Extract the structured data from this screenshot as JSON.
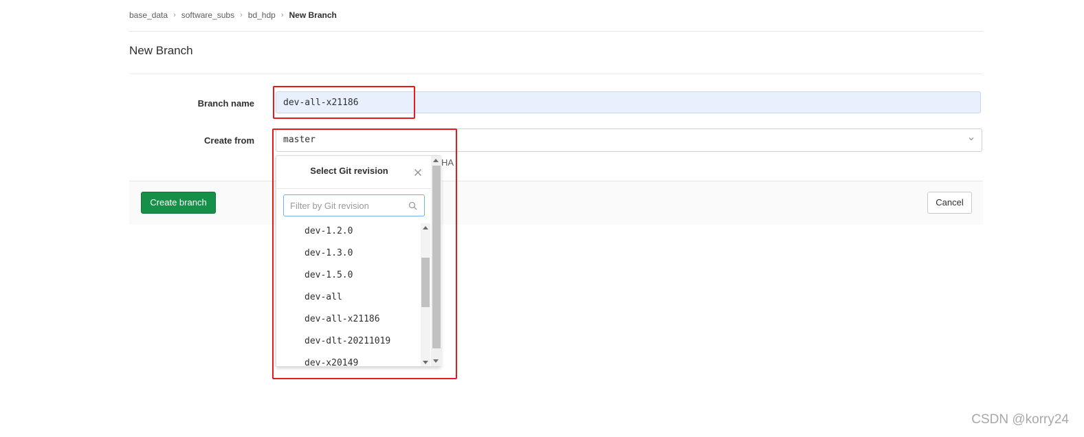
{
  "breadcrumb": [
    "base_data",
    "software_subs",
    "bd_hdp",
    "New Branch"
  ],
  "page_title": "New Branch",
  "form": {
    "branch_name_label": "Branch name",
    "branch_name_value": "dev-all-x21186",
    "create_from_label": "Create from",
    "create_from_value": "master",
    "help_text_fragment": "HA"
  },
  "buttons": {
    "create": "Create branch",
    "cancel": "Cancel"
  },
  "dropdown": {
    "title": "Select Git revision",
    "filter_placeholder": "Filter by Git revision",
    "items": [
      "dev-1.2.0",
      "dev-1.3.0",
      "dev-1.5.0",
      "dev-all",
      "dev-all-x21186",
      "dev-dlt-20211019",
      "dev-x20149"
    ]
  },
  "colors": {
    "primary_button": "#168f48",
    "highlight_box": "#e61a1a",
    "autofill_background": "#e8f0fe"
  },
  "watermark": "CSDN @korry24"
}
